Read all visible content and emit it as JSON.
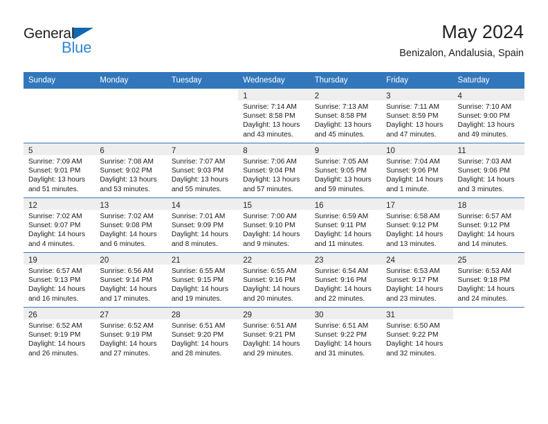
{
  "brand": {
    "name_dark": "General",
    "name_blue": "Blue",
    "logo_blue": "#1268b3",
    "accent": "#3277bc"
  },
  "header": {
    "title": "May 2024",
    "subtitle": "Benizalon, Andalusia, Spain"
  },
  "calendar": {
    "weekday_headers": [
      "Sunday",
      "Monday",
      "Tuesday",
      "Wednesday",
      "Thursday",
      "Friday",
      "Saturday"
    ],
    "weeks": [
      [
        {
          "day": "",
          "lines": []
        },
        {
          "day": "",
          "lines": []
        },
        {
          "day": "",
          "lines": []
        },
        {
          "day": "1",
          "lines": [
            "Sunrise: 7:14 AM",
            "Sunset: 8:58 PM",
            "Daylight: 13 hours",
            "and 43 minutes."
          ]
        },
        {
          "day": "2",
          "lines": [
            "Sunrise: 7:13 AM",
            "Sunset: 8:58 PM",
            "Daylight: 13 hours",
            "and 45 minutes."
          ]
        },
        {
          "day": "3",
          "lines": [
            "Sunrise: 7:11 AM",
            "Sunset: 8:59 PM",
            "Daylight: 13 hours",
            "and 47 minutes."
          ]
        },
        {
          "day": "4",
          "lines": [
            "Sunrise: 7:10 AM",
            "Sunset: 9:00 PM",
            "Daylight: 13 hours",
            "and 49 minutes."
          ]
        }
      ],
      [
        {
          "day": "5",
          "lines": [
            "Sunrise: 7:09 AM",
            "Sunset: 9:01 PM",
            "Daylight: 13 hours",
            "and 51 minutes."
          ]
        },
        {
          "day": "6",
          "lines": [
            "Sunrise: 7:08 AM",
            "Sunset: 9:02 PM",
            "Daylight: 13 hours",
            "and 53 minutes."
          ]
        },
        {
          "day": "7",
          "lines": [
            "Sunrise: 7:07 AM",
            "Sunset: 9:03 PM",
            "Daylight: 13 hours",
            "and 55 minutes."
          ]
        },
        {
          "day": "8",
          "lines": [
            "Sunrise: 7:06 AM",
            "Sunset: 9:04 PM",
            "Daylight: 13 hours",
            "and 57 minutes."
          ]
        },
        {
          "day": "9",
          "lines": [
            "Sunrise: 7:05 AM",
            "Sunset: 9:05 PM",
            "Daylight: 13 hours",
            "and 59 minutes."
          ]
        },
        {
          "day": "10",
          "lines": [
            "Sunrise: 7:04 AM",
            "Sunset: 9:06 PM",
            "Daylight: 14 hours",
            "and 1 minute."
          ]
        },
        {
          "day": "11",
          "lines": [
            "Sunrise: 7:03 AM",
            "Sunset: 9:06 PM",
            "Daylight: 14 hours",
            "and 3 minutes."
          ]
        }
      ],
      [
        {
          "day": "12",
          "lines": [
            "Sunrise: 7:02 AM",
            "Sunset: 9:07 PM",
            "Daylight: 14 hours",
            "and 4 minutes."
          ]
        },
        {
          "day": "13",
          "lines": [
            "Sunrise: 7:02 AM",
            "Sunset: 9:08 PM",
            "Daylight: 14 hours",
            "and 6 minutes."
          ]
        },
        {
          "day": "14",
          "lines": [
            "Sunrise: 7:01 AM",
            "Sunset: 9:09 PM",
            "Daylight: 14 hours",
            "and 8 minutes."
          ]
        },
        {
          "day": "15",
          "lines": [
            "Sunrise: 7:00 AM",
            "Sunset: 9:10 PM",
            "Daylight: 14 hours",
            "and 9 minutes."
          ]
        },
        {
          "day": "16",
          "lines": [
            "Sunrise: 6:59 AM",
            "Sunset: 9:11 PM",
            "Daylight: 14 hours",
            "and 11 minutes."
          ]
        },
        {
          "day": "17",
          "lines": [
            "Sunrise: 6:58 AM",
            "Sunset: 9:12 PM",
            "Daylight: 14 hours",
            "and 13 minutes."
          ]
        },
        {
          "day": "18",
          "lines": [
            "Sunrise: 6:57 AM",
            "Sunset: 9:12 PM",
            "Daylight: 14 hours",
            "and 14 minutes."
          ]
        }
      ],
      [
        {
          "day": "19",
          "lines": [
            "Sunrise: 6:57 AM",
            "Sunset: 9:13 PM",
            "Daylight: 14 hours",
            "and 16 minutes."
          ]
        },
        {
          "day": "20",
          "lines": [
            "Sunrise: 6:56 AM",
            "Sunset: 9:14 PM",
            "Daylight: 14 hours",
            "and 17 minutes."
          ]
        },
        {
          "day": "21",
          "lines": [
            "Sunrise: 6:55 AM",
            "Sunset: 9:15 PM",
            "Daylight: 14 hours",
            "and 19 minutes."
          ]
        },
        {
          "day": "22",
          "lines": [
            "Sunrise: 6:55 AM",
            "Sunset: 9:16 PM",
            "Daylight: 14 hours",
            "and 20 minutes."
          ]
        },
        {
          "day": "23",
          "lines": [
            "Sunrise: 6:54 AM",
            "Sunset: 9:16 PM",
            "Daylight: 14 hours",
            "and 22 minutes."
          ]
        },
        {
          "day": "24",
          "lines": [
            "Sunrise: 6:53 AM",
            "Sunset: 9:17 PM",
            "Daylight: 14 hours",
            "and 23 minutes."
          ]
        },
        {
          "day": "25",
          "lines": [
            "Sunrise: 6:53 AM",
            "Sunset: 9:18 PM",
            "Daylight: 14 hours",
            "and 24 minutes."
          ]
        }
      ],
      [
        {
          "day": "26",
          "lines": [
            "Sunrise: 6:52 AM",
            "Sunset: 9:19 PM",
            "Daylight: 14 hours",
            "and 26 minutes."
          ]
        },
        {
          "day": "27",
          "lines": [
            "Sunrise: 6:52 AM",
            "Sunset: 9:19 PM",
            "Daylight: 14 hours",
            "and 27 minutes."
          ]
        },
        {
          "day": "28",
          "lines": [
            "Sunrise: 6:51 AM",
            "Sunset: 9:20 PM",
            "Daylight: 14 hours",
            "and 28 minutes."
          ]
        },
        {
          "day": "29",
          "lines": [
            "Sunrise: 6:51 AM",
            "Sunset: 9:21 PM",
            "Daylight: 14 hours",
            "and 29 minutes."
          ]
        },
        {
          "day": "30",
          "lines": [
            "Sunrise: 6:51 AM",
            "Sunset: 9:22 PM",
            "Daylight: 14 hours",
            "and 31 minutes."
          ]
        },
        {
          "day": "31",
          "lines": [
            "Sunrise: 6:50 AM",
            "Sunset: 9:22 PM",
            "Daylight: 14 hours",
            "and 32 minutes."
          ]
        },
        {
          "day": "",
          "lines": []
        }
      ]
    ]
  }
}
